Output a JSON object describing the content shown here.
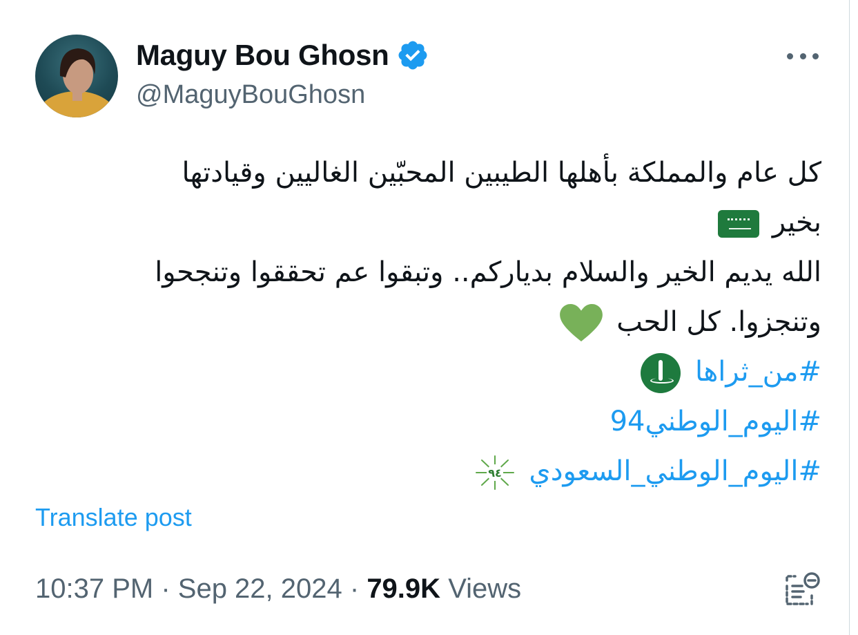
{
  "author": {
    "display_name": "Maguy Bou Ghosn",
    "handle": "@MaguyBouGhosn",
    "verified": true,
    "avatar_icon": "profile-photo"
  },
  "tweet": {
    "line1": "كل عام والمملكة بأهلها الطيبين المحبّين الغاليين وقيادتها",
    "line2": "بخير",
    "line3": "الله يديم الخير والسلام بدياركم.. وتبقوا عم تحققوا وتنجحوا",
    "line4": "وتنجزوا. كل الحب",
    "hashtags": [
      "#من_ثراها",
      "#اليوم_الوطني94",
      "#اليوم_الوطني_السعودي"
    ],
    "emoji": {
      "flag": "saudi-arabia-flag",
      "heart": "green-heart",
      "emblem": "saudi-emblem",
      "national_day": "national-day-94-emoji"
    }
  },
  "translate_label": "Translate post",
  "meta": {
    "time": "10:37 PM",
    "separator": " · ",
    "date": "Sep 22, 2024",
    "views_count": "79.9K",
    "views_label": "Views"
  },
  "colors": {
    "link": "#1d9bf0",
    "secondary_text": "#536471",
    "primary_text": "#0f1419",
    "verified": "#1d9bf0",
    "heart_green": "#78b159",
    "flag_green": "#1f7a3d"
  },
  "icons": {
    "more": "more-horizontal-icon",
    "verified": "verified-badge-icon",
    "bookmark_action": "grok-summary-icon"
  }
}
